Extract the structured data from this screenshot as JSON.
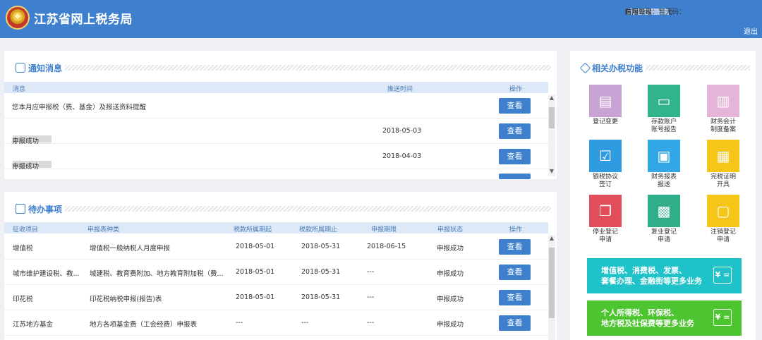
{
  "header": {
    "site_title": "江苏省网上税务局",
    "credit_code_label": "统一社会信用代码：",
    "taxpayer_label": "纳税人名称：",
    "taxpayer_prefix": "苏州",
    "taxpayer_suffix": "有限公司",
    "credit_level": "信用等级：暂无",
    "logout": "退出"
  },
  "notices": {
    "title": "通知消息",
    "columns": [
      "消息",
      "推送时间",
      "操作"
    ],
    "rows": [
      {
        "msg": "您本月应申报税（费、基金）及报送资料提醒",
        "time": "",
        "action": "查看"
      },
      {
        "msg_prefix": "苏州",
        "msg_suffix": "申报成功",
        "time": "2018-05-03",
        "action": "查看"
      },
      {
        "msg_prefix": "苏州",
        "msg_suffix": "申报成功",
        "time": "2018-04-03",
        "action": "查看"
      }
    ]
  },
  "todo": {
    "title": "待办事项",
    "columns": [
      "征收项目",
      "申报表种类",
      "税款所属期起",
      "税款所属期止",
      "申报期限",
      "申报状态",
      "操作"
    ],
    "rows": [
      {
        "item": "增值税",
        "form": "增值税一般纳税人月度申报",
        "start": "2018-05-01",
        "end": "2018-05-31",
        "deadline": "2018-06-15",
        "status": "申报成功",
        "action": "查看"
      },
      {
        "item": "城市维护建设税、教...",
        "form": "城建税、教育费附加、地方教育附加税（费...",
        "start": "2018-05-01",
        "end": "2018-05-31",
        "deadline": "---",
        "status": "申报成功",
        "action": "查看"
      },
      {
        "item": "印花税",
        "form": "印花税纳税申报(报告)表",
        "start": "2018-05-01",
        "end": "2018-05-31",
        "deadline": "---",
        "status": "申报成功",
        "action": "查看"
      },
      {
        "item": "江苏地方基金",
        "form": "地方各项基金费（工会经费）申报表",
        "start": "---",
        "end": "---",
        "deadline": "---",
        "status": "申报成功",
        "action": "查看"
      }
    ]
  },
  "related": {
    "title": "相关办税功能",
    "tiles": [
      {
        "label1": "登记变更",
        "label2": "",
        "icon": "registration-change-icon",
        "color": "#c9a3d3"
      },
      {
        "label1": "存款账户",
        "label2": "账号报告",
        "icon": "bank-card-icon",
        "color": "#31b38b"
      },
      {
        "label1": "财务会计",
        "label2": "制度备案",
        "icon": "notebook-icon",
        "color": "#e5b4d9"
      },
      {
        "label1": "银税协议",
        "label2": "签订",
        "icon": "checklist-icon",
        "color": "#2f9be0"
      },
      {
        "label1": "财务报表",
        "label2": "报送",
        "icon": "briefcase-icon",
        "color": "#33a7e6"
      },
      {
        "label1": "完税证明",
        "label2": "开具",
        "icon": "certificate-icon",
        "color": "#f5c518"
      },
      {
        "label1": "停业登记",
        "label2": "申请",
        "icon": "document-stack-icon",
        "color": "#e24d5a"
      },
      {
        "label1": "复业登记",
        "label2": "申请",
        "icon": "printer-icon",
        "color": "#2fae89"
      },
      {
        "label1": "注销登记",
        "label2": "申请",
        "icon": "monitor-icon",
        "color": "#f5c518"
      }
    ],
    "banners": [
      {
        "line1": "增值税、消费税、发票、",
        "line2": "套餐办理、金融街等更多业务",
        "color": "#1fc2c9",
        "icon_text": "¥ ="
      },
      {
        "line1": "个人所得税、环保税、",
        "line2": "地方税及社保费等更多业务",
        "color": "#4cc531",
        "icon_text": "¥ ="
      }
    ]
  }
}
